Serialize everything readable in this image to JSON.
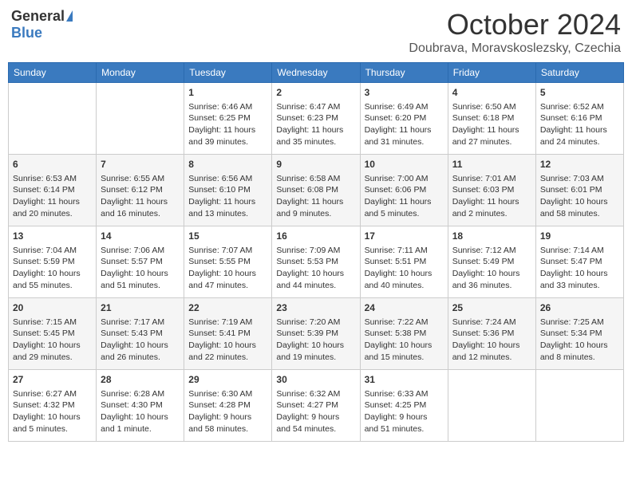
{
  "header": {
    "logo_general": "General",
    "logo_blue": "Blue",
    "month_title": "October 2024",
    "location": "Doubrava, Moravskoslezsky, Czechia"
  },
  "days_of_week": [
    "Sunday",
    "Monday",
    "Tuesday",
    "Wednesday",
    "Thursday",
    "Friday",
    "Saturday"
  ],
  "weeks": [
    [
      {
        "day": "",
        "info": ""
      },
      {
        "day": "",
        "info": ""
      },
      {
        "day": "1",
        "info": "Sunrise: 6:46 AM\nSunset: 6:25 PM\nDaylight: 11 hours and 39 minutes."
      },
      {
        "day": "2",
        "info": "Sunrise: 6:47 AM\nSunset: 6:23 PM\nDaylight: 11 hours and 35 minutes."
      },
      {
        "day": "3",
        "info": "Sunrise: 6:49 AM\nSunset: 6:20 PM\nDaylight: 11 hours and 31 minutes."
      },
      {
        "day": "4",
        "info": "Sunrise: 6:50 AM\nSunset: 6:18 PM\nDaylight: 11 hours and 27 minutes."
      },
      {
        "day": "5",
        "info": "Sunrise: 6:52 AM\nSunset: 6:16 PM\nDaylight: 11 hours and 24 minutes."
      }
    ],
    [
      {
        "day": "6",
        "info": "Sunrise: 6:53 AM\nSunset: 6:14 PM\nDaylight: 11 hours and 20 minutes."
      },
      {
        "day": "7",
        "info": "Sunrise: 6:55 AM\nSunset: 6:12 PM\nDaylight: 11 hours and 16 minutes."
      },
      {
        "day": "8",
        "info": "Sunrise: 6:56 AM\nSunset: 6:10 PM\nDaylight: 11 hours and 13 minutes."
      },
      {
        "day": "9",
        "info": "Sunrise: 6:58 AM\nSunset: 6:08 PM\nDaylight: 11 hours and 9 minutes."
      },
      {
        "day": "10",
        "info": "Sunrise: 7:00 AM\nSunset: 6:06 PM\nDaylight: 11 hours and 5 minutes."
      },
      {
        "day": "11",
        "info": "Sunrise: 7:01 AM\nSunset: 6:03 PM\nDaylight: 11 hours and 2 minutes."
      },
      {
        "day": "12",
        "info": "Sunrise: 7:03 AM\nSunset: 6:01 PM\nDaylight: 10 hours and 58 minutes."
      }
    ],
    [
      {
        "day": "13",
        "info": "Sunrise: 7:04 AM\nSunset: 5:59 PM\nDaylight: 10 hours and 55 minutes."
      },
      {
        "day": "14",
        "info": "Sunrise: 7:06 AM\nSunset: 5:57 PM\nDaylight: 10 hours and 51 minutes."
      },
      {
        "day": "15",
        "info": "Sunrise: 7:07 AM\nSunset: 5:55 PM\nDaylight: 10 hours and 47 minutes."
      },
      {
        "day": "16",
        "info": "Sunrise: 7:09 AM\nSunset: 5:53 PM\nDaylight: 10 hours and 44 minutes."
      },
      {
        "day": "17",
        "info": "Sunrise: 7:11 AM\nSunset: 5:51 PM\nDaylight: 10 hours and 40 minutes."
      },
      {
        "day": "18",
        "info": "Sunrise: 7:12 AM\nSunset: 5:49 PM\nDaylight: 10 hours and 36 minutes."
      },
      {
        "day": "19",
        "info": "Sunrise: 7:14 AM\nSunset: 5:47 PM\nDaylight: 10 hours and 33 minutes."
      }
    ],
    [
      {
        "day": "20",
        "info": "Sunrise: 7:15 AM\nSunset: 5:45 PM\nDaylight: 10 hours and 29 minutes."
      },
      {
        "day": "21",
        "info": "Sunrise: 7:17 AM\nSunset: 5:43 PM\nDaylight: 10 hours and 26 minutes."
      },
      {
        "day": "22",
        "info": "Sunrise: 7:19 AM\nSunset: 5:41 PM\nDaylight: 10 hours and 22 minutes."
      },
      {
        "day": "23",
        "info": "Sunrise: 7:20 AM\nSunset: 5:39 PM\nDaylight: 10 hours and 19 minutes."
      },
      {
        "day": "24",
        "info": "Sunrise: 7:22 AM\nSunset: 5:38 PM\nDaylight: 10 hours and 15 minutes."
      },
      {
        "day": "25",
        "info": "Sunrise: 7:24 AM\nSunset: 5:36 PM\nDaylight: 10 hours and 12 minutes."
      },
      {
        "day": "26",
        "info": "Sunrise: 7:25 AM\nSunset: 5:34 PM\nDaylight: 10 hours and 8 minutes."
      }
    ],
    [
      {
        "day": "27",
        "info": "Sunrise: 6:27 AM\nSunset: 4:32 PM\nDaylight: 10 hours and 5 minutes."
      },
      {
        "day": "28",
        "info": "Sunrise: 6:28 AM\nSunset: 4:30 PM\nDaylight: 10 hours and 1 minute."
      },
      {
        "day": "29",
        "info": "Sunrise: 6:30 AM\nSunset: 4:28 PM\nDaylight: 9 hours and 58 minutes."
      },
      {
        "day": "30",
        "info": "Sunrise: 6:32 AM\nSunset: 4:27 PM\nDaylight: 9 hours and 54 minutes."
      },
      {
        "day": "31",
        "info": "Sunrise: 6:33 AM\nSunset: 4:25 PM\nDaylight: 9 hours and 51 minutes."
      },
      {
        "day": "",
        "info": ""
      },
      {
        "day": "",
        "info": ""
      }
    ]
  ]
}
